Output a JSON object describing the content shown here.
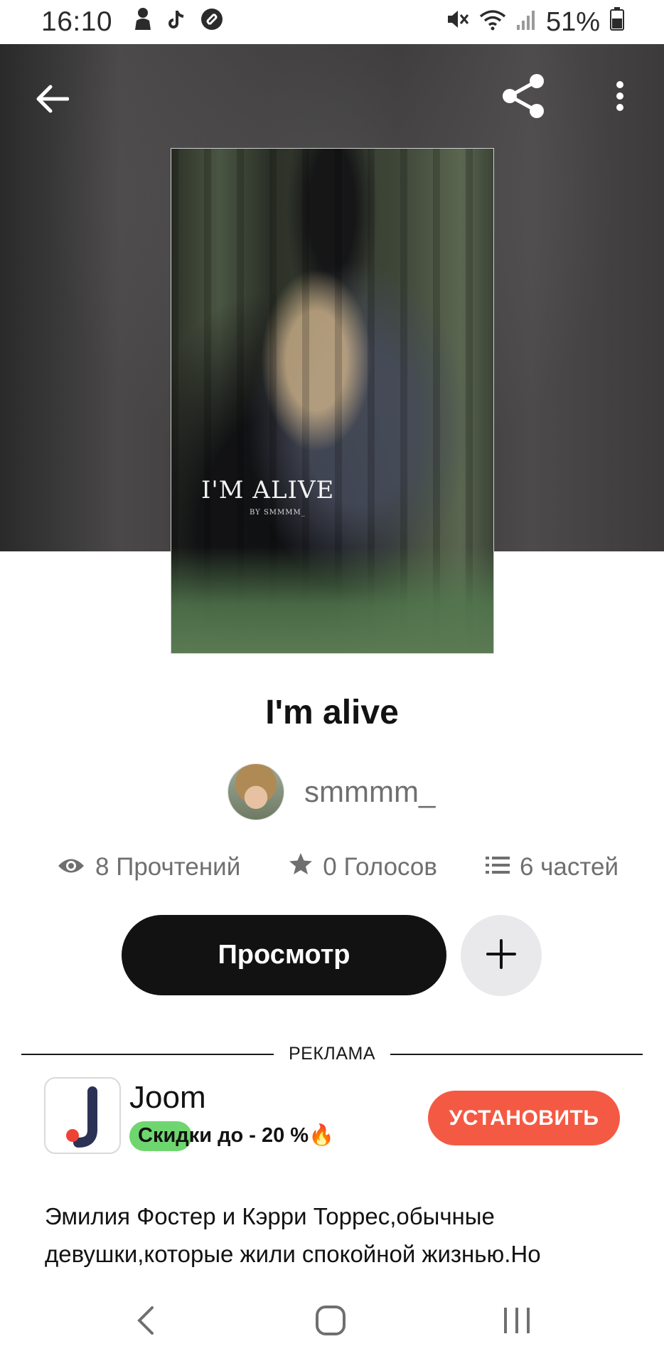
{
  "status_bar": {
    "time": "16:10",
    "battery": "51%",
    "icons": [
      "person-icon",
      "tiktok-icon",
      "shazam-icon",
      "mute-icon",
      "wifi-icon",
      "signal-icon",
      "battery-icon"
    ]
  },
  "header": {
    "icons": [
      "back-arrow-icon",
      "share-icon",
      "more-vert-icon"
    ]
  },
  "cover": {
    "art_title": "I'M ALIVE",
    "art_byline": "BY SMMMM_"
  },
  "story": {
    "title": "I'm alive",
    "author": "smmmm_",
    "stats": {
      "reads": "8 Прочтений",
      "votes": "0 Голосов",
      "parts": "6 частей"
    },
    "read_button": "Просмотр",
    "description": "Эмилия Фостер и Кэрри Торрес,обычные девушки,которые жили спокойной жизнью.Но"
  },
  "ad": {
    "label": "РЕКЛАМА",
    "app_name": "Joom",
    "promo": "Скидки до - 20 %🔥",
    "install_button": "УСТАНОВИТЬ",
    "accent": "#f45a43",
    "highlight": "#6fd66f"
  },
  "nav_bar": {
    "icons": [
      "nav-back-icon",
      "nav-home-icon",
      "nav-recents-icon"
    ]
  }
}
